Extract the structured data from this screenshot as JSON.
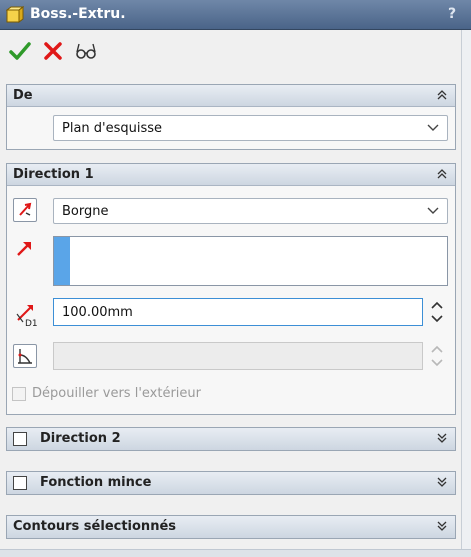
{
  "window": {
    "title": "Boss.-Extru.",
    "help_label": "?"
  },
  "actions": [
    {
      "name": "ok",
      "icon": "green-check-icon"
    },
    {
      "name": "cancel",
      "icon": "red-x-icon"
    },
    {
      "name": "preview",
      "icon": "glasses-icon"
    }
  ],
  "from": {
    "title": "De",
    "value": "Plan d'esquisse"
  },
  "direction1": {
    "title": "Direction 1",
    "end_condition": "Borgne",
    "depth": "100.00mm",
    "draft_outward_label": "Dépouiller vers l'extérieur"
  },
  "direction2": {
    "title": "Direction 2"
  },
  "thin_feature": {
    "title": "Fonction mince"
  },
  "selected_contours": {
    "title": "Contours sélectionnés"
  },
  "colors": {
    "title_bar": "#4a6488",
    "accent_blue": "#3c8fd6",
    "selection_blue": "#5aa5e8",
    "arrow_red": "#e01818",
    "ok_green": "#2f9a2a"
  }
}
